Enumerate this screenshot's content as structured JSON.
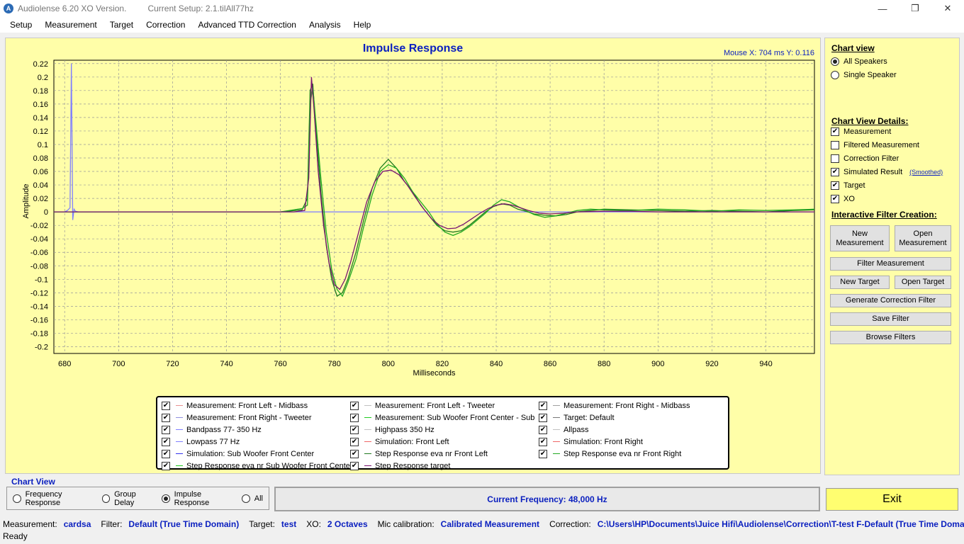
{
  "window": {
    "title": "Audiolense 6.20 XO Version.",
    "setup": "Current Setup: 2.1.tilAll77hz",
    "minimize": "—",
    "maximize": "❐",
    "close": "✕"
  },
  "menu": [
    "Setup",
    "Measurement",
    "Target",
    "Correction",
    "Advanced TTD Correction",
    "Analysis",
    "Help"
  ],
  "chart": {
    "title": "Impulse Response",
    "mouse_readout": "Mouse X: 704 ms   Y: 0.116"
  },
  "chart_data": {
    "type": "line",
    "title": "Impulse Response",
    "xlabel": "Milliseconds",
    "ylabel": "Amplitude",
    "xlim": [
      676,
      958
    ],
    "ylim": [
      -0.21,
      0.225
    ],
    "grid": true,
    "x_ticks": [
      680,
      700,
      720,
      740,
      760,
      780,
      800,
      820,
      840,
      860,
      880,
      900,
      920,
      940
    ],
    "y_ticks": [
      0.22,
      0.2,
      0.18,
      0.16,
      0.14,
      0.12,
      0.1,
      0.08,
      0.06,
      0.04,
      0.02,
      0,
      -0.02,
      -0.04,
      -0.06,
      -0.08,
      -0.1,
      -0.12,
      -0.14,
      -0.16,
      -0.18,
      -0.2
    ],
    "y_tick_labels": [
      "0.22",
      "0.2",
      "0.18",
      "0.16",
      "0.14",
      "0.12",
      "0.1",
      "0.08",
      "0.06",
      "0.04",
      "0.02",
      "0",
      "-0.02",
      "-0.04",
      "-0.06",
      "-0.08",
      "-0.1",
      "-0.12",
      "-0.14",
      "-0.16",
      "-0.18",
      "-0.2"
    ],
    "series": [
      {
        "name": "Simulation: Sub Woofer Front Center",
        "color": "#8080ff",
        "x": [
          676,
          680,
          681,
          682,
          682.5,
          683,
          683.5,
          684,
          685,
          690,
          958
        ],
        "y": [
          0,
          0,
          0.002,
          0.006,
          0.22,
          -0.012,
          0.004,
          0.001,
          0,
          0,
          0
        ]
      },
      {
        "name": "Step Response eva nr Front Left",
        "color": "#207a20",
        "x": [
          676,
          760,
          768,
          770,
          771,
          772,
          773,
          775,
          777,
          779,
          781,
          783,
          785,
          788,
          791,
          794,
          797,
          800,
          803,
          806,
          809,
          812,
          815,
          818,
          821,
          824,
          827,
          830,
          833,
          836,
          839,
          842,
          845,
          848,
          851,
          854,
          858,
          862,
          866,
          870,
          875,
          880,
          890,
          900,
          910,
          920,
          930,
          940,
          950,
          958
        ],
        "y": [
          0,
          0,
          0.003,
          0.02,
          0.18,
          0.19,
          0.13,
          0.03,
          -0.05,
          -0.1,
          -0.125,
          -0.12,
          -0.1,
          -0.06,
          -0.01,
          0.035,
          0.065,
          0.078,
          0.065,
          0.045,
          0.03,
          0.01,
          -0.005,
          -0.02,
          -0.028,
          -0.03,
          -0.028,
          -0.02,
          -0.01,
          0,
          0.008,
          0.012,
          0.01,
          0.004,
          0.001,
          -0.003,
          -0.005,
          -0.006,
          -0.004,
          0,
          0.002,
          0.004,
          0.003,
          0.002,
          0.001,
          0.002,
          0.001,
          0,
          0.002,
          0.003
        ]
      },
      {
        "name": "Step Response eva nr Front Right",
        "color": "#22aa22",
        "x": [
          676,
          760,
          768,
          770,
          771,
          772,
          773,
          775,
          777,
          779,
          781,
          783,
          785,
          788,
          791,
          794,
          797,
          800,
          803,
          806,
          809,
          812,
          815,
          818,
          821,
          824,
          827,
          830,
          833,
          836,
          839,
          842,
          845,
          848,
          851,
          854,
          858,
          862,
          866,
          870,
          875,
          880,
          890,
          900,
          910,
          920,
          930,
          940,
          950,
          958
        ],
        "y": [
          0,
          0,
          0.005,
          0.01,
          0.16,
          0.185,
          0.14,
          0.05,
          -0.03,
          -0.085,
          -0.115,
          -0.125,
          -0.105,
          -0.07,
          -0.02,
          0.025,
          0.06,
          0.07,
          0.065,
          0.05,
          0.03,
          0.015,
          0,
          -0.018,
          -0.03,
          -0.035,
          -0.03,
          -0.022,
          -0.012,
          -0.002,
          0.01,
          0.018,
          0.015,
          0.008,
          0.002,
          -0.004,
          -0.008,
          -0.006,
          -0.002,
          0.002,
          0.004,
          0.003,
          0.002,
          0.004,
          0.003,
          0.001,
          0.003,
          0.002,
          0.003,
          0.004
        ]
      },
      {
        "name": "Step Response target",
        "color": "#7a1470",
        "x": [
          676,
          765,
          769,
          770.5,
          771.5,
          772.5,
          774,
          776,
          778,
          780,
          782,
          784,
          786,
          789,
          792,
          795,
          798,
          801,
          804,
          807,
          810,
          813,
          816,
          819,
          822,
          825,
          828,
          831,
          834,
          837,
          840,
          843,
          846,
          849,
          852,
          856,
          860,
          865,
          870,
          880,
          890,
          900,
          958
        ],
        "y": [
          0,
          0,
          0.002,
          0.05,
          0.2,
          0.15,
          0.06,
          -0.02,
          -0.075,
          -0.108,
          -0.115,
          -0.1,
          -0.075,
          -0.03,
          0.015,
          0.045,
          0.06,
          0.062,
          0.055,
          0.04,
          0.022,
          0.005,
          -0.01,
          -0.02,
          -0.025,
          -0.024,
          -0.018,
          -0.01,
          -0.002,
          0.005,
          0.01,
          0.012,
          0.01,
          0.006,
          0.002,
          -0.002,
          -0.003,
          -0.002,
          0,
          0.001,
          0.001,
          0,
          0
        ]
      }
    ]
  },
  "legend": [
    {
      "label": "Measurement: Front Left - Midbass",
      "color": "#e89090",
      "checked": true
    },
    {
      "label": "Measurement: Front Left - Tweeter",
      "color": "#c0c0c0",
      "checked": true
    },
    {
      "label": "Measurement: Front Right - Midbass",
      "color": "#a0a0a0",
      "checked": true
    },
    {
      "label": "Measurement: Front Right - Tweeter",
      "color": "#9090e0",
      "checked": true
    },
    {
      "label": "Measurement: Sub Woofer Front Center - Sub",
      "color": "#22cc22",
      "checked": true
    },
    {
      "label": "Target: Default",
      "color": "#777777",
      "checked": true
    },
    {
      "label": "Bandpass   77- 350 Hz",
      "color": "#8080ff",
      "checked": true
    },
    {
      "label": "Highpass   350 Hz",
      "color": "#c0c0c0",
      "checked": true
    },
    {
      "label": "Allpass",
      "color": "#c0c0c0",
      "checked": true
    },
    {
      "label": "Lowpass  77 Hz",
      "color": "#8080ff",
      "checked": true
    },
    {
      "label": "Simulation: Front Left",
      "color": "#ee6666",
      "checked": true
    },
    {
      "label": "Simulation: Front Right",
      "color": "#ee6666",
      "checked": true
    },
    {
      "label": "Simulation: Sub Woofer Front Center",
      "color": "#3333ee",
      "checked": true
    },
    {
      "label": "Step Response eva nr Front Left",
      "color": "#207a20",
      "checked": true
    },
    {
      "label": "Step Response eva nr Front Right",
      "color": "#22aa22",
      "checked": true
    },
    {
      "label": "Step Response eva nr Sub Woofer Front Center",
      "color": "#22cc22",
      "checked": true
    },
    {
      "label": "Step Response target",
      "color": "#7a1470",
      "checked": true
    }
  ],
  "right_panel": {
    "chart_view_heading": "Chart view",
    "all_speakers": "All Speakers",
    "single_speaker": "Single Speaker",
    "details_heading": "Chart View Details:",
    "details": [
      {
        "label": "Measurement",
        "checked": true
      },
      {
        "label": "Filtered Measurement",
        "checked": false
      },
      {
        "label": "Correction Filter",
        "checked": false
      },
      {
        "label": "Simulated Result",
        "checked": true
      },
      {
        "label": "Target",
        "checked": true
      },
      {
        "label": "XO",
        "checked": true
      }
    ],
    "smoothed": "(Smoothed)",
    "interactive_heading": "Interactive Filter Creation:",
    "new_measurement": "New Measurement",
    "open_measurement": "Open Measurement",
    "filter_measurement": "Filter Measurement",
    "new_target": "New Target",
    "open_target": "Open Target",
    "generate_correction_filter": "Generate Correction Filter",
    "save_filter": "Save Filter",
    "browse_filters": "Browse Filters"
  },
  "bottom": {
    "chart_view_heading": "Chart View",
    "frequency_response": "Frequency Response",
    "group_delay": "Group Delay",
    "impulse_response": "Impulse Response",
    "all": "All",
    "selected": "impulse_response",
    "current_frequency": "Current Frequency: 48,000 Hz",
    "exit": "Exit"
  },
  "status": {
    "measurement_label": "Measurement:",
    "measurement_value": "cardsa",
    "filter_label": "Filter:",
    "filter_value": "Default (True Time Domain)",
    "target_label": "Target:",
    "target_value": "test",
    "xo_label": "XO:",
    "xo_value": "2 Octaves",
    "mic_label": "Mic calibration:",
    "mic_value": "Calibrated Measurement",
    "correction_label": "Correction:",
    "correction_value": "C:\\Users\\HP\\Documents\\Juice Hifi\\Audiolense\\Correction\\T-test F-Default (True Time Domain) I",
    "ready": "Ready"
  }
}
